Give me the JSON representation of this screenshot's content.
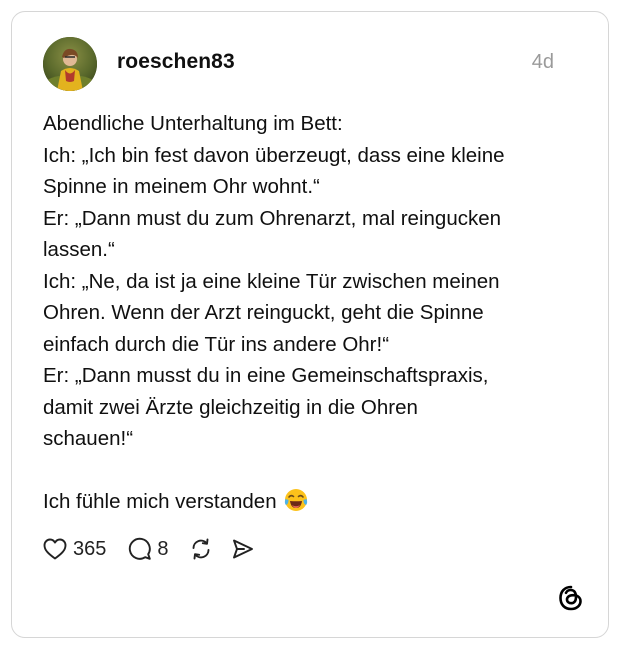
{
  "post": {
    "author": {
      "username": "roeschen83"
    },
    "timestamp": "4d",
    "lines": [
      "Abendliche Unterhaltung im Bett:",
      "Ich: „Ich bin fest davon überzeugt, dass eine kleine",
      "Spinne in meinem Ohr wohnt.“",
      "Er: „Dann must du zum Ohrenarzt, mal reingucken",
      "lassen.“",
      "Ich: „Ne, da ist ja eine kleine Tür zwischen meinen",
      "Ohren. Wenn der Arzt reinguckt, geht die Spinne",
      "einfach durch die Tür ins andere Ohr!“",
      "Er: „Dann musst du in eine Gemeinschaftspraxis,",
      "damit zwei Ärzte gleichzeitig in die Ohren",
      "schauen!“",
      "",
      "Ich fühle mich verstanden"
    ],
    "closing_emoji": "face-with-tears-of-joy"
  },
  "actions": {
    "likes": "365",
    "replies": "8"
  },
  "icons": {
    "like": "heart-icon",
    "reply": "speech-bubble-icon",
    "repost": "repost-icon",
    "share": "send-icon",
    "brand": "threads-logo-icon"
  }
}
